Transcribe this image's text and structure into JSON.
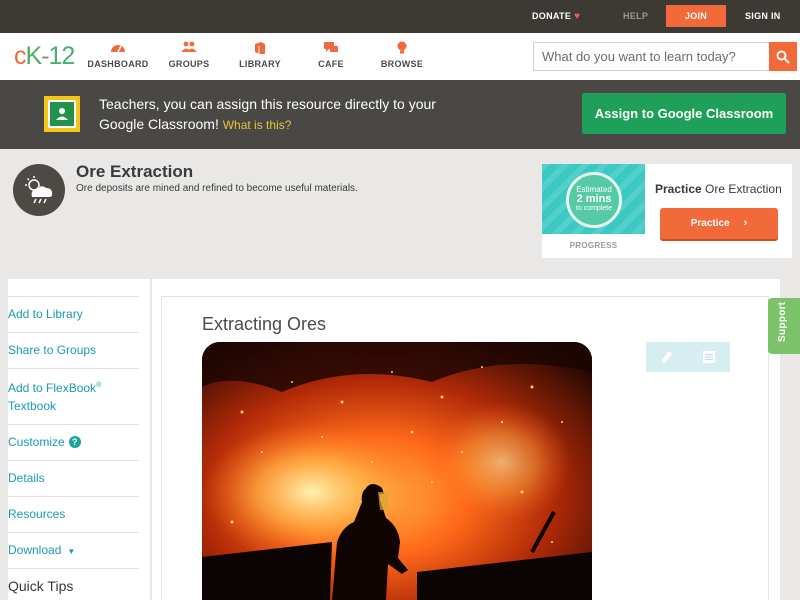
{
  "topbar": {
    "donate": "DONATE",
    "help": "HELP",
    "join": "JOIN",
    "signin": "SIGN IN"
  },
  "logo": {
    "c": "c",
    "k": "K",
    "dash": "-",
    "num": "12"
  },
  "nav": {
    "items": [
      {
        "label": "DASHBOARD",
        "icon": "dashboard-icon"
      },
      {
        "label": "GROUPS",
        "icon": "groups-icon"
      },
      {
        "label": "LIBRARY",
        "icon": "library-icon"
      },
      {
        "label": "CAFE",
        "icon": "cafe-icon"
      },
      {
        "label": "BROWSE",
        "icon": "browse-icon"
      }
    ]
  },
  "search": {
    "placeholder": "What do you want to learn today?",
    "value": ""
  },
  "banner": {
    "text": "Teachers, you can assign this resource directly to your Google Classroom!",
    "link": "What is this?",
    "assign_button": "Assign to Google Classroom"
  },
  "concept": {
    "title": "Ore Extraction",
    "description": "Ore deposits are mined and refined to become useful materials."
  },
  "practice": {
    "estimated": "Estimated",
    "mins": "2 mins",
    "to_complete": "to complete",
    "progress_label": "PROGRESS",
    "title_bold": "Practice",
    "title_rest": "Ore Extraction",
    "button": "Practice"
  },
  "sidebar": {
    "items": [
      {
        "label": "Add to Library"
      },
      {
        "label": "Share to Groups"
      },
      {
        "label": "Add to FlexBook",
        "sup": "®",
        "line2": "Textbook"
      },
      {
        "label": "Customize"
      },
      {
        "label": "Details"
      },
      {
        "label": "Resources"
      },
      {
        "label": "Download"
      }
    ],
    "quick_tips": "Quick Tips"
  },
  "main": {
    "section_title": "Extracting Ores",
    "tools": [
      "pencil-icon",
      "notes-icon"
    ]
  },
  "support": {
    "label": "Support"
  },
  "colors": {
    "brand_orange": "#f26a3a",
    "brand_green": "#46b06a",
    "link_teal": "#1a9bb0",
    "classroom_green": "#1e9f5a"
  }
}
